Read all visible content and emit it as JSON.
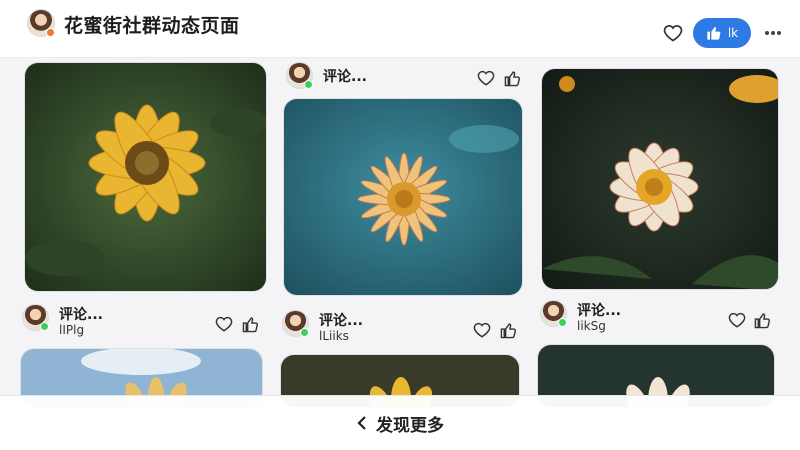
{
  "page": {
    "title": "花蜜街社群动态页面"
  },
  "header": {
    "like_label": "lk"
  },
  "cards": [
    {
      "meta_title": "评论...",
      "meta_sub": "lIPlg"
    },
    {
      "meta_title": "评论...",
      "meta_sub": ""
    },
    {
      "meta_title": "评论...",
      "meta_sub": "lLiiks"
    },
    {
      "meta_title": "评论...",
      "meta_sub": "likSg"
    }
  ],
  "footer": {
    "label": "发现更多"
  },
  "colors": {
    "accent": "#2f7be5",
    "online": "#3ccf5a",
    "status_orange": "#f07a2a"
  },
  "icons": [
    "heart-icon",
    "thumbs-up-icon",
    "more-icon",
    "chevron-left-icon"
  ]
}
